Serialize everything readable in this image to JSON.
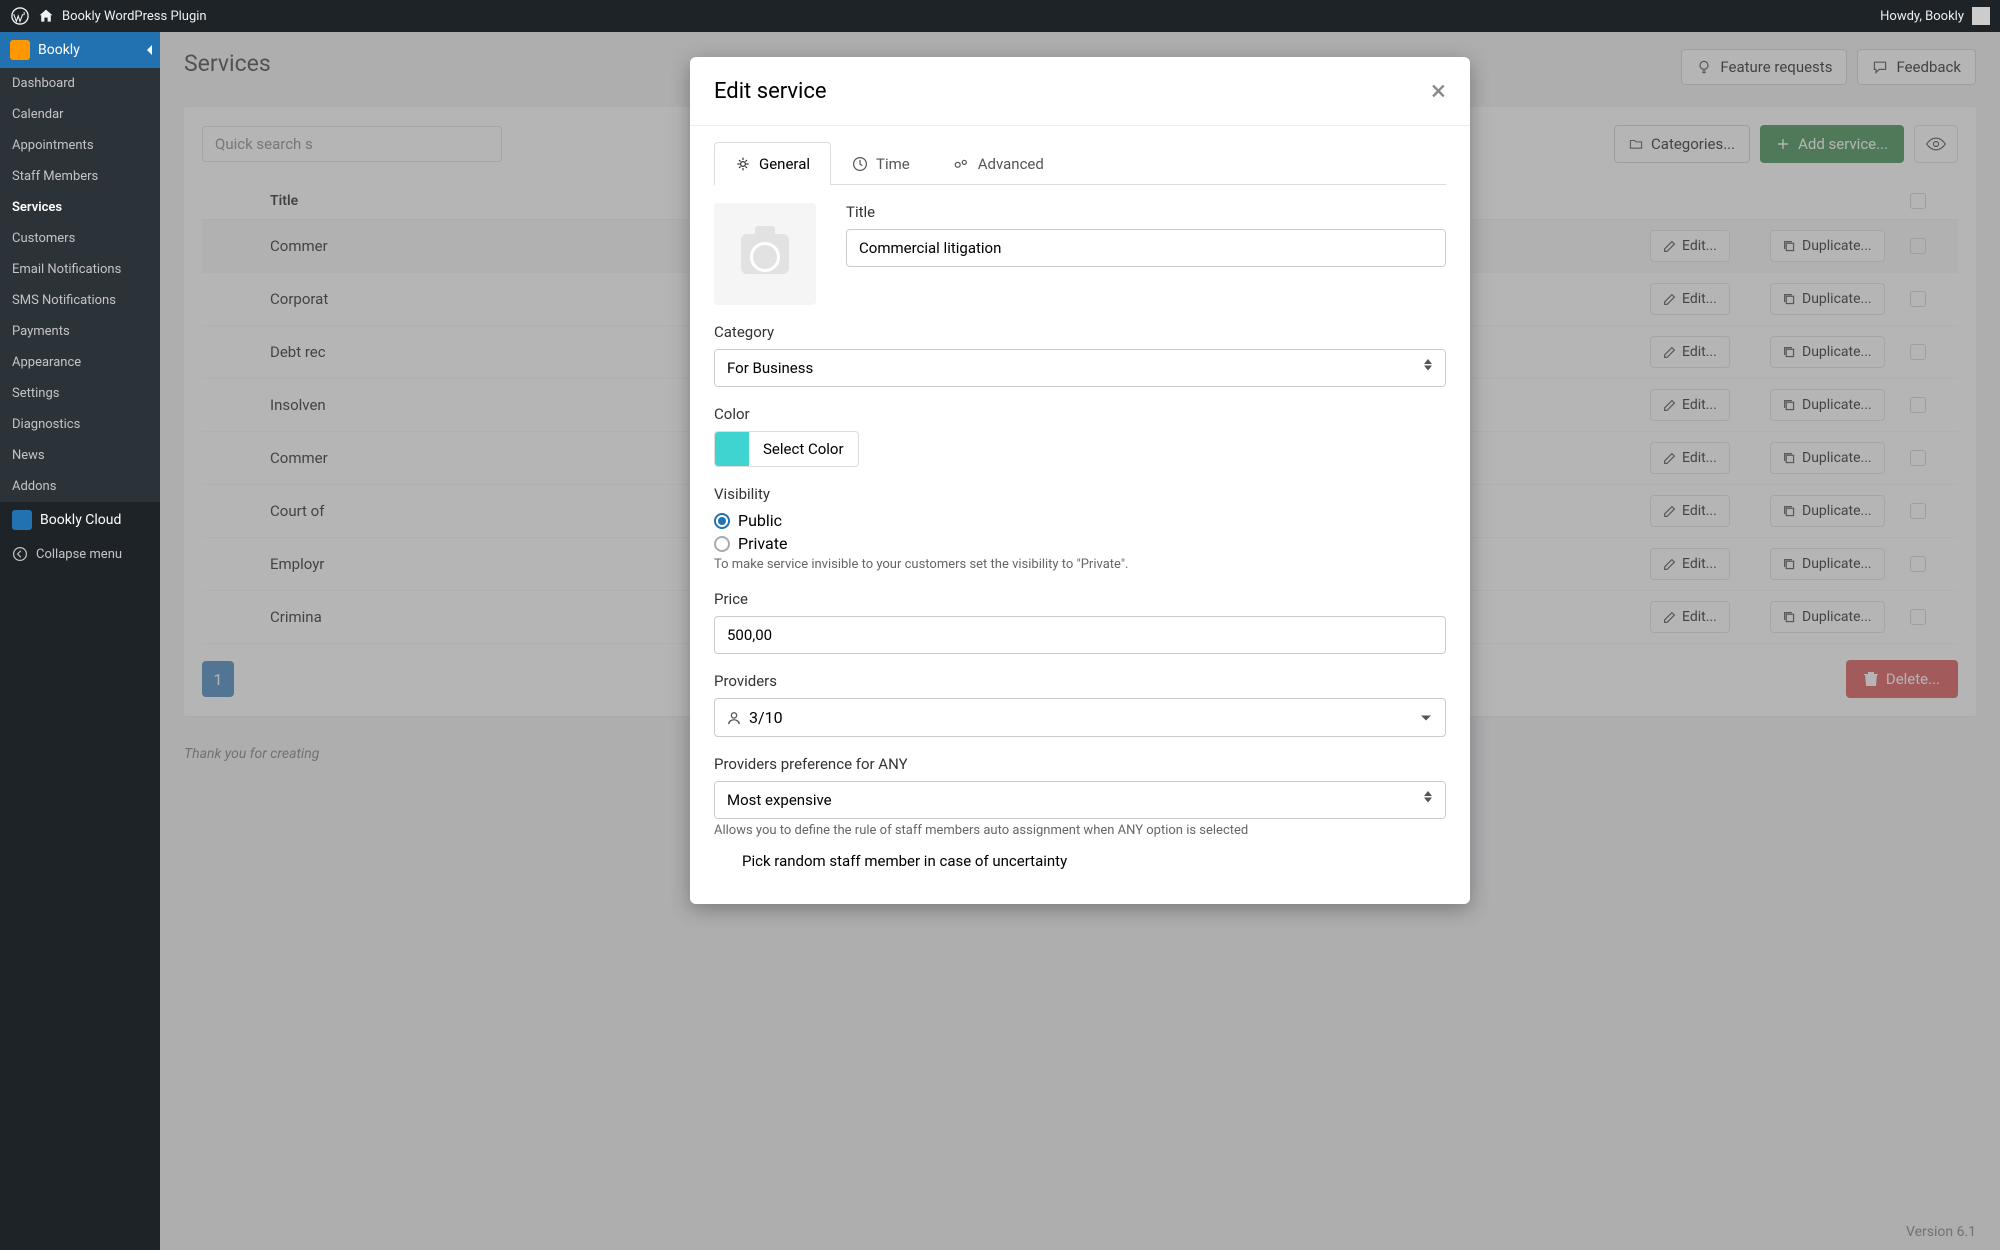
{
  "adminBar": {
    "siteTitle": "Bookly WordPress Plugin",
    "greeting": "Howdy, Bookly"
  },
  "sidebar": {
    "head": "Bookly",
    "items": [
      "Dashboard",
      "Calendar",
      "Appointments",
      "Staff Members",
      "Services",
      "Customers",
      "Email Notifications",
      "SMS Notifications",
      "Payments",
      "Appearance",
      "Settings",
      "Diagnostics",
      "News",
      "Addons"
    ],
    "activeIndex": 4,
    "cloud": "Bookly Cloud",
    "collapse": "Collapse menu"
  },
  "page": {
    "title": "Services",
    "featureRequests": "Feature requests",
    "feedback": "Feedback",
    "searchPlaceholder": "Quick search s",
    "categoriesBtn": "Categories...",
    "addServiceBtn": "Add service...",
    "tableHeader": {
      "title": "Title",
      "edit": "Edit...",
      "duplicate": "Duplicate..."
    },
    "rows": [
      {
        "color": "#3fd4d0",
        "title": "Commer"
      },
      {
        "color": "#c0392b",
        "title": "Corporat"
      },
      {
        "color": "#d4a016",
        "title": "Debt rec"
      },
      {
        "color": "#27ae60",
        "title": "Insolven"
      },
      {
        "color": "#5b2cc4",
        "title": "Commer"
      },
      {
        "color": "#1e55c4",
        "title": "Court of"
      },
      {
        "color": "#8e44ad",
        "title": "Employr"
      },
      {
        "color": "#1abc9c",
        "title": "Crimina"
      }
    ],
    "pageNumber": "1",
    "deleteBtn": "Delete...",
    "footerNote": "Thank you for creating",
    "version": "Version 6.1"
  },
  "modal": {
    "title": "Edit service",
    "tabs": {
      "general": "General",
      "time": "Time",
      "advanced": "Advanced"
    },
    "fields": {
      "titleLabel": "Title",
      "titleValue": "Commercial litigation",
      "categoryLabel": "Category",
      "categoryValue": "For Business",
      "colorLabel": "Color",
      "colorSwatch": "#3fd4d0",
      "colorBtn": "Select Color",
      "visibilityLabel": "Visibility",
      "publicLabel": "Public",
      "privateLabel": "Private",
      "visibilityHelp": "To make service invisible to your customers set the visibility to \"Private\".",
      "priceLabel": "Price",
      "priceValue": "500,00",
      "providersLabel": "Providers",
      "providersValue": "3/10",
      "prefLabel": "Providers preference for ANY",
      "prefValue": "Most expensive",
      "prefHelp": "Allows you to define the rule of staff members auto assignment when ANY option is selected",
      "randomLabel": "Pick random staff member in case of uncertainty"
    }
  }
}
